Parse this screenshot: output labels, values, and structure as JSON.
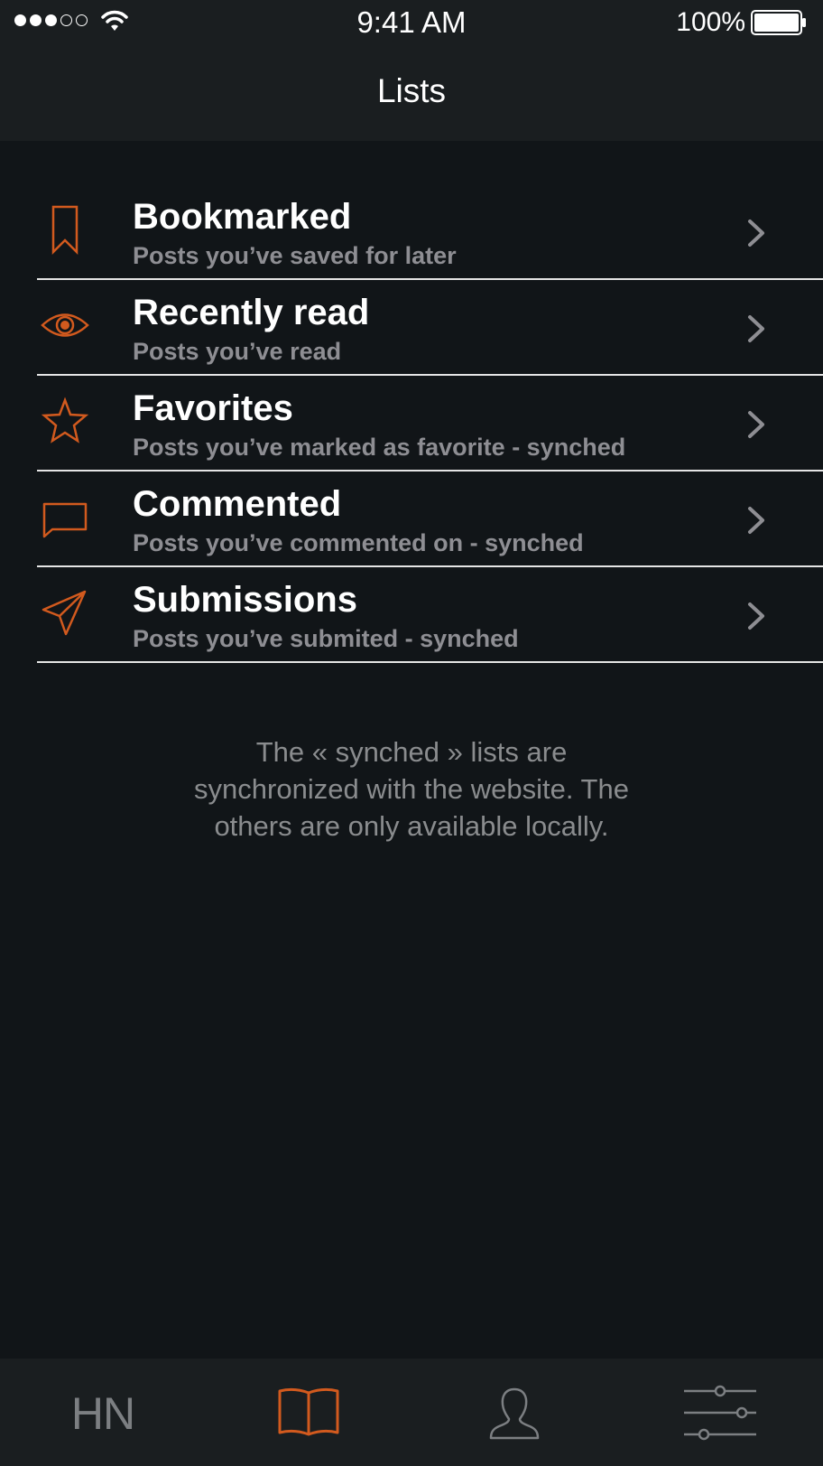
{
  "status_bar": {
    "time": "9:41 AM",
    "battery": "100%",
    "signal_bars_filled": 3,
    "signal_bars_total": 5,
    "icons": [
      "signal-dots-icon",
      "wifi-icon",
      "battery-icon"
    ]
  },
  "nav": {
    "title": "Lists"
  },
  "lists": [
    {
      "title": "Bookmarked",
      "subtitle": "Posts you’ve saved for later",
      "icon": "bookmark-icon"
    },
    {
      "title": "Recently read",
      "subtitle": "Posts you’ve read",
      "icon": "eye-icon"
    },
    {
      "title": "Favorites",
      "subtitle": "Posts you’ve marked as favorite - synched",
      "icon": "star-icon"
    },
    {
      "title": "Commented",
      "subtitle": "Posts you’ve commented on - synched",
      "icon": "comment-icon"
    },
    {
      "title": "Submissions",
      "subtitle": "Posts you’ve submited - synched",
      "icon": "paper-plane-icon"
    }
  ],
  "footnote": {
    "line1": "The « synched » lists are",
    "line2": "synchronized with the website. The",
    "line3": "others are only available locally."
  },
  "tab_bar": {
    "tabs": [
      {
        "label": "HN",
        "icon": "hn-text-icon",
        "active": false
      },
      {
        "label": "",
        "icon": "book-icon",
        "active": true
      },
      {
        "label": "",
        "icon": "user-icon",
        "active": false
      },
      {
        "label": "",
        "icon": "sliders-icon",
        "active": false
      }
    ]
  },
  "colors": {
    "accent": "#d25a1e",
    "background": "#111518",
    "bar_background": "#1a1e20",
    "subtitle": "#8e8e93",
    "inactive_tab": "#7c7f82"
  }
}
